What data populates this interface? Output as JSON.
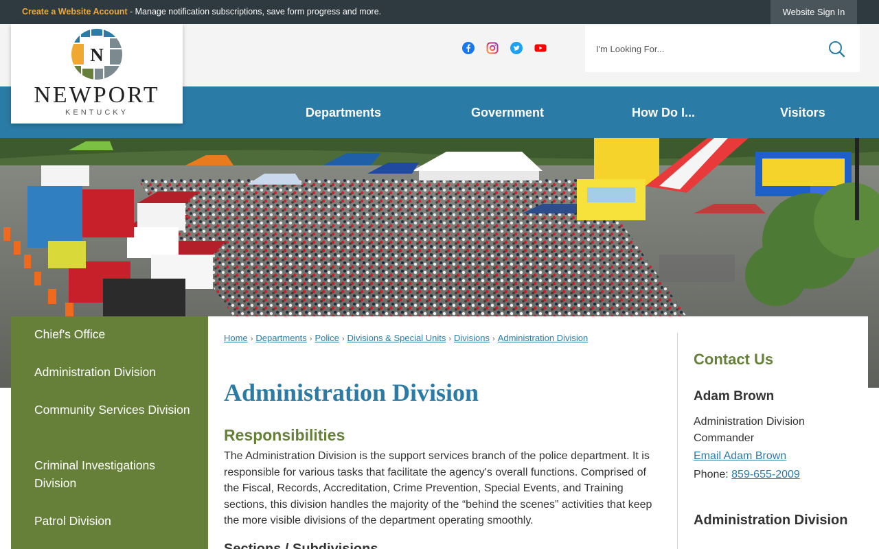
{
  "topbar": {
    "create_account": "Create a Website Account",
    "message": " - Manage notification subscriptions, save form progress and more.",
    "sign_in": "Website Sign In"
  },
  "logo": {
    "letter": "N",
    "name": "NEWPORT",
    "sub": "KENTUCKY"
  },
  "social": [
    "facebook-icon",
    "instagram-icon",
    "twitter-icon",
    "youtube-icon"
  ],
  "search": {
    "placeholder": "I'm Looking For..."
  },
  "nav": {
    "items": [
      "Departments",
      "Government",
      "How Do I...",
      "Visitors"
    ]
  },
  "sidenav": {
    "items": [
      "Chief's Office",
      "Administration Division",
      "Community Services Division",
      "Criminal Investigations Division",
      "Patrol Division"
    ]
  },
  "breadcrumb": [
    "Home",
    "Departments",
    "Police",
    "Divisions & Special Units",
    "Divisions",
    "Administration Division"
  ],
  "main": {
    "title": "Administration Division",
    "section_title": "Responsibilities",
    "section_body": "The Administration Division is the support services branch of the police department. It is responsible for various tasks that facilitate the agency's overall functions. Comprised of the Fiscal, Records, Accreditation, Crime Prevention, Special Events, and Training sections, this division handles the majority of the “behind the scenes” activities that keep the more visible divisions of the department operating smoothly.",
    "section2_title": "Sections / Subdivisions"
  },
  "contact": {
    "title": "Contact Us",
    "name": "Adam Brown",
    "role": "Administration Division Commander",
    "email_label": "Email Adam Brown",
    "phone_label": "Phone: ",
    "phone": "859-655-2009",
    "section2_title": "Administration Division"
  },
  "colors": {
    "brand_blue": "#2a7ba6",
    "brand_green": "#66803a",
    "topbar": "#2f3a40",
    "accent_orange": "#f0a830"
  }
}
